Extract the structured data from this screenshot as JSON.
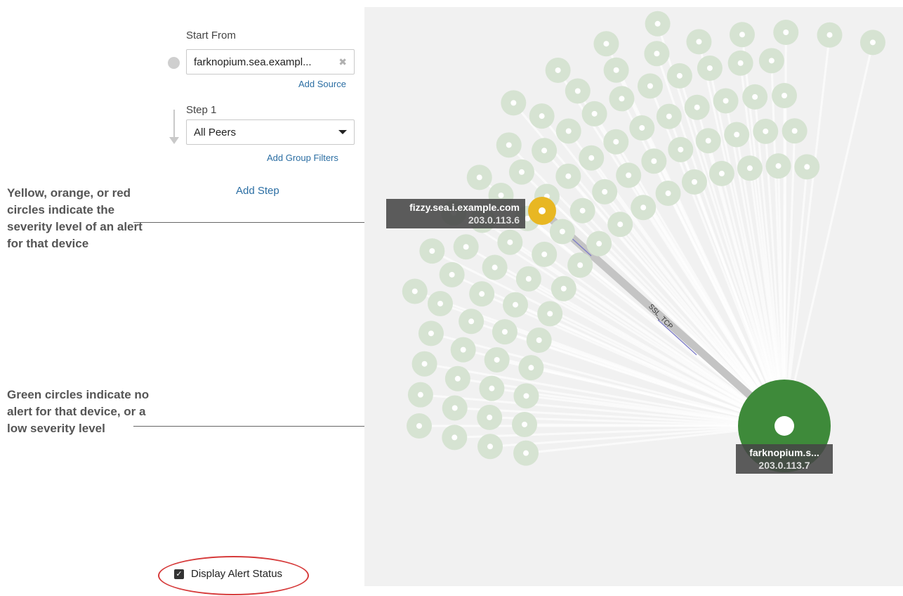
{
  "left_panel": {
    "start_from_label": "Start From",
    "source_value": "farknopium.sea.exampl...",
    "add_source": "Add Source",
    "step_label": "Step 1",
    "step_value": "All Peers",
    "add_group_filters": "Add Group Filters",
    "add_step": "Add Step",
    "display_alert_status": "Display Alert Status",
    "display_alert_status_checked": true
  },
  "annotations": {
    "alert": "Yellow, orange, or red circles indicate the severity level of an alert for that device",
    "no_alert": "Green circles indicate no alert for that device, or a low severity level"
  },
  "graph": {
    "alert_node": {
      "name": "fizzy.sea.i.example.com",
      "ip": "203.0.113.6",
      "color": "#e8b723"
    },
    "source_node": {
      "name": "farknopium.s...",
      "ip": "203.0.113.7",
      "color": "#3e8a3a"
    },
    "connection_label": "SSL_TCP",
    "peer_color": "#d6e3d2",
    "peer_center_color": "#ffffff"
  }
}
